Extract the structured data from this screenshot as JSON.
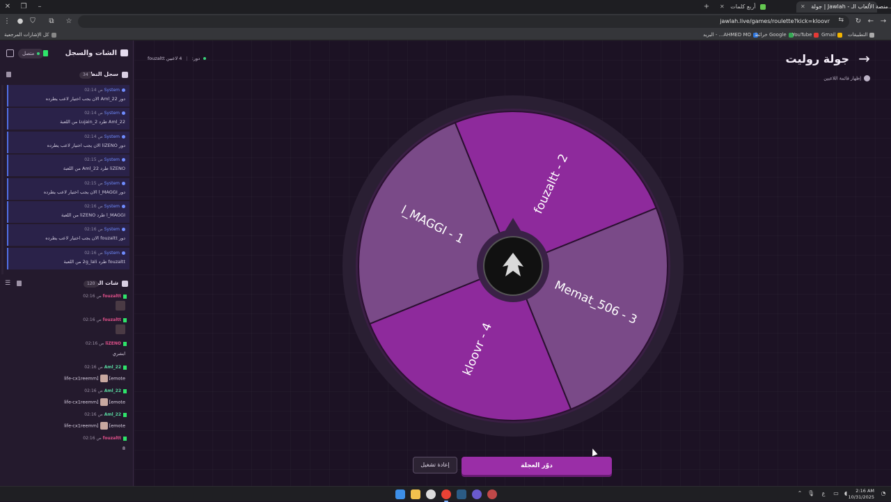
{
  "browser": {
    "tabs": [
      {
        "label": "أربع كلمات",
        "color": "#64c850",
        "active": false
      },
      {
        "label": "جولة | Jawlah - منصة الألعاب الـ...",
        "color": "#8a6bd0",
        "active": true
      }
    ],
    "url": "jawlah.live/games/roulette?kick=kloovr",
    "bookmarks": {
      "apps": "التطبيقات",
      "gmail": "Gmail",
      "youtube": "YouTube",
      "maps": "خرائط Google",
      "mail": "البريد - ...AHMED MO",
      "all": "كل الإشارات المرجعية"
    }
  },
  "sidebar": {
    "title": "الشات والسجل",
    "status": "متصل",
    "system_log": {
      "title": "سجل النظام",
      "count": "34",
      "items": [
        {
          "sender": "System",
          "time": "02:14 ص",
          "text": "دور Aml_22 الان يجب اختيار لاعب يطرده"
        },
        {
          "sender": "System",
          "time": "02:14 ص",
          "text": "Aml_22 طرد Lujain_2 من اللعبة"
        },
        {
          "sender": "System",
          "time": "02:14 ص",
          "text": "دور liZENO الان يجب اختيار لاعب يطرده"
        },
        {
          "sender": "System",
          "time": "02:15 ص",
          "text": "liZENO طرد Aml_22 من اللعبة"
        },
        {
          "sender": "System",
          "time": "02:15 ص",
          "text": "دور l_MAGGI الان يجب اختيار لاعب يطرده"
        },
        {
          "sender": "System",
          "time": "02:16 ص",
          "text": "l_MAGGI طرد liZENO من اللعبة"
        },
        {
          "sender": "System",
          "time": "02:16 ص",
          "text": "دور fouzaltt الان يجب اختيار لاعب يطرده"
        },
        {
          "sender": "System",
          "time": "02:16 ص",
          "text": "fouzaltt طرد 2g_lali من اللعبة"
        }
      ]
    },
    "stream_chat": {
      "title": "شات البث",
      "count": "120",
      "messages": [
        {
          "user": "fouzaltt",
          "time": "02:16 ص",
          "color": "#e0508a",
          "text": "",
          "sticker": true
        },
        {
          "user": "fouzaltt",
          "time": "02:16 ص",
          "color": "#e0508a",
          "text": "",
          "sticker": true
        },
        {
          "user": "liZENO",
          "time": "02:16 ص",
          "color": "#e0508a",
          "text": "ابشري",
          "sticker": false
        },
        {
          "user": "Aml_22",
          "time": "02:16 ص",
          "color": "#59d8a0",
          "text": "[emote",
          "emote": "life-cx1reemm]",
          "sticker": false
        },
        {
          "user": "Aml_22",
          "time": "02:16 ص",
          "color": "#59d8a0",
          "text": "[emote",
          "emote": "life-cx1reemm]",
          "sticker": false
        },
        {
          "user": "Aml_22",
          "time": "02:16 ص",
          "color": "#59d8a0",
          "text": "[emote",
          "emote": "life-cx1reemm]",
          "sticker": false
        },
        {
          "user": "fouzaltt",
          "time": "02:16 ص",
          "color": "#e0508a",
          "text": "8",
          "sticker": false
        }
      ]
    }
  },
  "main": {
    "title": "جولة روليت",
    "show_players": "إظهار قائمة اللاعبين",
    "players_count": "4 لاعبين",
    "turn_label": "دور:",
    "turn_player": "fouzaltt",
    "spin_button": "دوّر العجلة",
    "restart_button": "إعادة تشغيل"
  },
  "wheel": {
    "segments": [
      {
        "label": "l_MAGGI - 1",
        "color": "#7a4a88"
      },
      {
        "label": "fouzaltt - 2",
        "color": "#8e2a9c"
      },
      {
        "label": "Memat_506 - 3",
        "color": "#7a4a88"
      },
      {
        "label": "kloovr - 4",
        "color": "#8e2a9c"
      }
    ]
  },
  "taskbar": {
    "time": "2:16 AM",
    "date": "10/31/2025",
    "lang": "ع"
  },
  "colors": {
    "accent": "#9a2ea7",
    "background": "#1c1224",
    "log_item": "#2a2249"
  }
}
